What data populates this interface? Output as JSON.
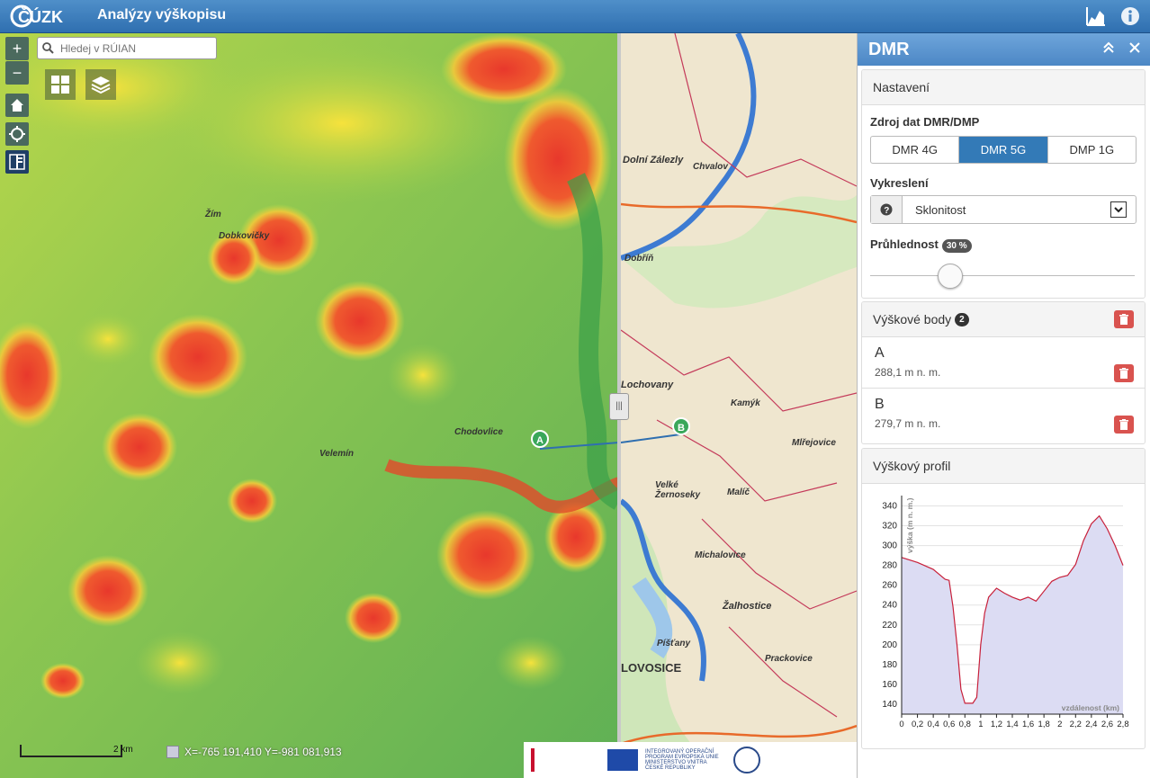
{
  "header": {
    "logo_text": "ČÚZK",
    "title": "Analýzy výškopisu"
  },
  "map": {
    "search_placeholder": "Hledej v RÚIAN",
    "coords": "X=-765 191,410  Y=-981 081,913",
    "scale_label": "2 km",
    "marker_a": "A",
    "marker_b": "B",
    "divider_handle": "|||",
    "place_labels_left": [
      "Žím",
      "Dobkovičky",
      "Velemín",
      "Chodovlice"
    ],
    "place_labels_right": [
      "Dolní Zálezly",
      "Chvalov",
      "Dobříň",
      "Lochovany",
      "Kamýk",
      "Mlřejovice",
      "Velké Žernoseky",
      "Malíč",
      "Michalovice",
      "Žalhostice",
      "Píšťany",
      "LOVOSICE",
      "Prackovice"
    ],
    "logos_text": "INTEGROVANÝ OPERAČNÍ PROGRAM  EVROPSKÁ UNIE  MINISTERSTVO VNITRA ČESKÉ REPUBLIKY"
  },
  "panel": {
    "title": "DMR",
    "settings": {
      "heading": "Nastavení",
      "source_label": "Zdroj dat DMR/DMP",
      "source_options": [
        "DMR 4G",
        "DMR 5G",
        "DMP 1G"
      ],
      "source_selected": "DMR 5G",
      "render_label": "Vykreslení",
      "render_value": "Sklonitost",
      "opacity_label": "Průhlednost",
      "opacity_value": "30 %",
      "opacity_fraction": 0.3
    },
    "points": {
      "heading": "Výškové body",
      "count": "2",
      "items": [
        {
          "name": "A",
          "value": "288,1 m n. m."
        },
        {
          "name": "B",
          "value": "279,7 m n. m."
        }
      ]
    },
    "profile": {
      "heading": "Výškový profil"
    }
  },
  "chart_data": {
    "type": "area",
    "ylabel": "výška (m n. m.)",
    "xlabel": "vzdálenost (km)",
    "ylim": [
      130,
      345
    ],
    "xlim": [
      0,
      2.8
    ],
    "y_ticks": [
      140,
      160,
      180,
      200,
      220,
      240,
      260,
      280,
      300,
      320,
      340
    ],
    "x_ticks": [
      "0",
      "0,2",
      "0,4",
      "0,6",
      "0,8",
      "1",
      "1,2",
      "1,4",
      "1,6",
      "1,8",
      "2",
      "2,2",
      "2,4",
      "2,6",
      "2,8"
    ],
    "x": [
      0,
      0.2,
      0.4,
      0.55,
      0.6,
      0.65,
      0.7,
      0.75,
      0.8,
      0.9,
      0.95,
      1.0,
      1.05,
      1.1,
      1.2,
      1.3,
      1.4,
      1.5,
      1.6,
      1.7,
      1.8,
      1.9,
      2.0,
      2.1,
      2.2,
      2.3,
      2.4,
      2.5,
      2.6,
      2.7,
      2.8
    ],
    "y": [
      288,
      283,
      276,
      266,
      265,
      238,
      200,
      155,
      141,
      141,
      147,
      200,
      232,
      248,
      257,
      252,
      248,
      245,
      248,
      244,
      254,
      264,
      268,
      270,
      281,
      305,
      322,
      330,
      317,
      300,
      280
    ],
    "grid": true
  }
}
